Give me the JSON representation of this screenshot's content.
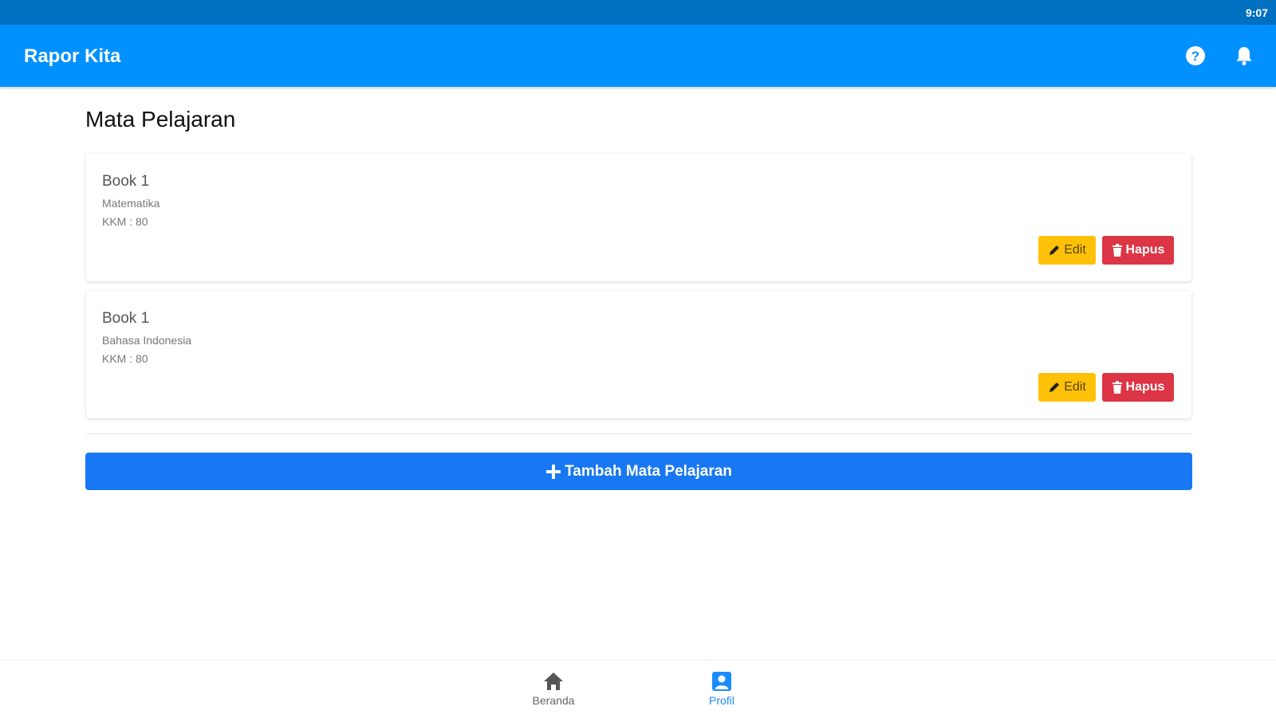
{
  "status_bar": {
    "time": "9:07"
  },
  "app_bar": {
    "title": "Rapor Kita",
    "help_icon": "question-circle-icon",
    "bell_icon": "bell-icon",
    "color": "#0091ff"
  },
  "page": {
    "title": "Mata Pelajaran"
  },
  "subjects": [
    {
      "title": "Book 1",
      "subject": "Matematika",
      "kkm": "KKM : 80",
      "edit_label": "Edit",
      "delete_label": "Hapus"
    },
    {
      "title": "Book 1",
      "subject": "Bahasa Indonesia",
      "kkm": "KKM : 80",
      "edit_label": "Edit",
      "delete_label": "Hapus"
    }
  ],
  "add_button": {
    "label": "Tambah Mata Pelajaran",
    "icon": "plus-icon",
    "color": "#1877f2"
  },
  "bottom_nav": {
    "items": [
      {
        "label": "Beranda",
        "icon": "home-icon",
        "active": false
      },
      {
        "label": "Profil",
        "icon": "profile-icon",
        "active": true
      }
    ],
    "active_color": "#1a8cff"
  },
  "colors": {
    "edit": "#ffc107",
    "delete": "#dc3545"
  }
}
